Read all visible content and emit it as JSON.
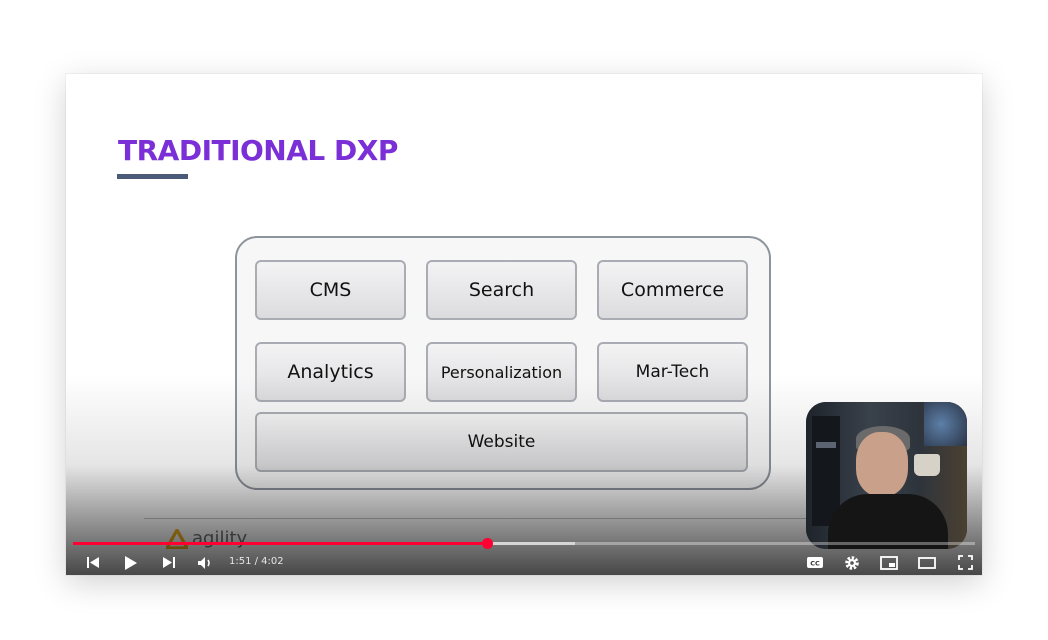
{
  "slide": {
    "title": "TRADITIONAL DXP",
    "modules": {
      "cms": "CMS",
      "search": "Search",
      "commerce": "Commerce",
      "analytics": "Analytics",
      "personalization": "Personalization",
      "martech": "Mar-Tech",
      "website": "Website"
    },
    "brand": "agility",
    "title_color": "#7b2fd6"
  },
  "player": {
    "current_time": "1:51",
    "duration": "4:02",
    "time_display": "1:51 / 4:02",
    "progress_fraction": 0.459,
    "buffered_fraction": 0.556,
    "accent_color": "#ff0033",
    "controls": [
      "previous-icon",
      "play-icon",
      "next-icon",
      "volume-icon",
      "captions-icon",
      "settings-icon",
      "miniplayer-icon",
      "theater-icon",
      "fullscreen-icon"
    ]
  }
}
